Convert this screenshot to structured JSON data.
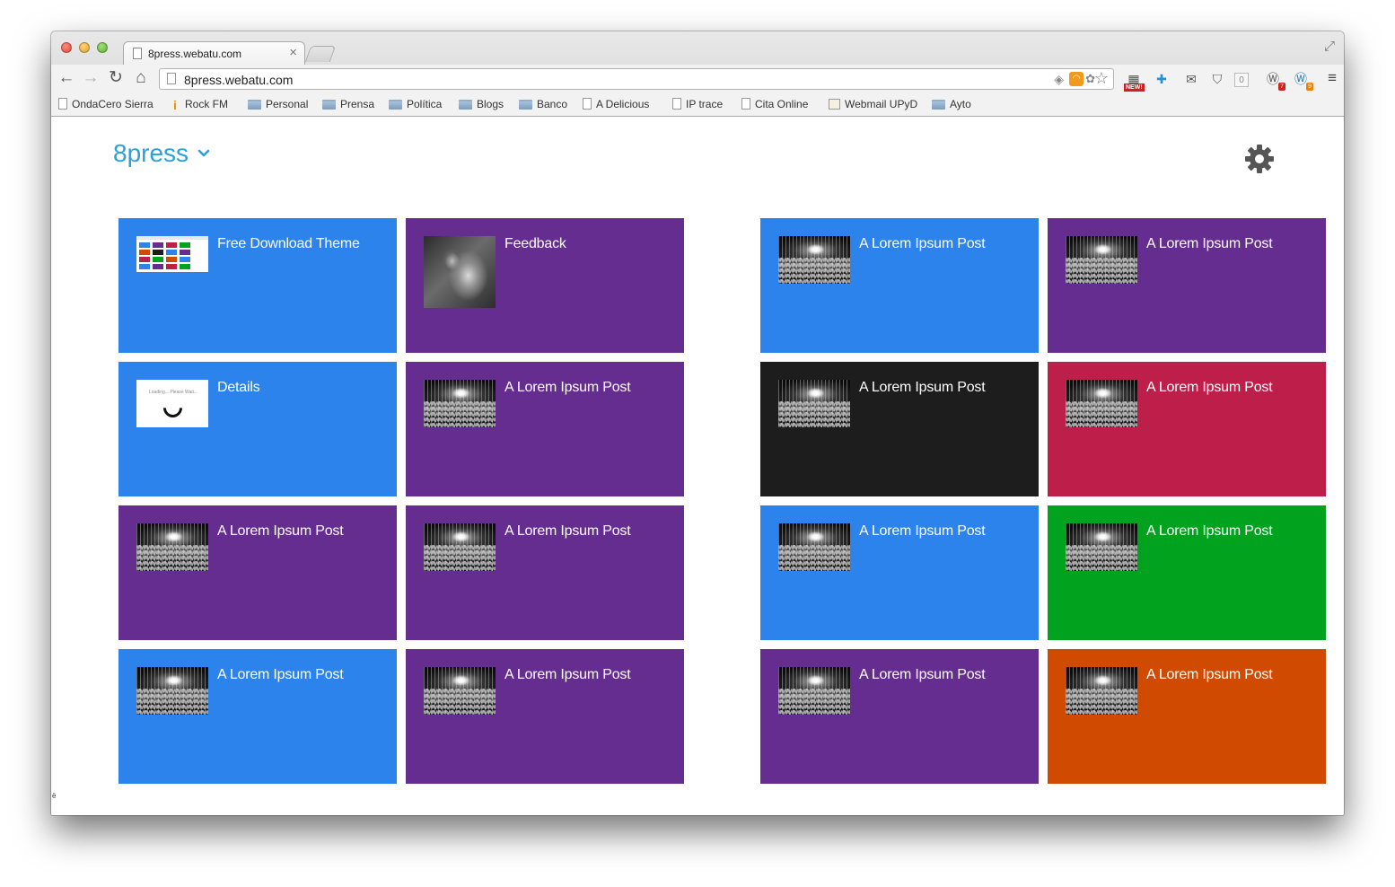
{
  "browser": {
    "tab_title": "8press.webatu.com",
    "url": "8press.webatu.com",
    "bookmarks": [
      {
        "label": "OndaCero Sierra",
        "icon": "page-icon"
      },
      {
        "label": "Rock FM",
        "icon": "radio-icon"
      },
      {
        "label": "Personal",
        "icon": "folder-icon"
      },
      {
        "label": "Prensa",
        "icon": "folder-icon"
      },
      {
        "label": "Política",
        "icon": "folder-icon"
      },
      {
        "label": "Blogs",
        "icon": "folder-icon"
      },
      {
        "label": "Banco",
        "icon": "folder-icon"
      },
      {
        "label": "A Delicious",
        "icon": "page-icon"
      },
      {
        "label": "IP trace",
        "icon": "page-icon"
      },
      {
        "label": "Cita Online",
        "icon": "page-icon"
      },
      {
        "label": "Webmail UPyD",
        "icon": "mail-icon"
      },
      {
        "label": "Ayto",
        "icon": "folder-icon"
      }
    ],
    "extensions": {
      "new_badge": "NEW!",
      "counter": "0",
      "wp_badge_1": "7",
      "wp_badge_2": "9"
    }
  },
  "page": {
    "brand": "8press",
    "colors": {
      "brand": "#2d9fd9",
      "blue": "#2c83ec",
      "purple": "#662d91",
      "black": "#1d1d1d",
      "crimson": "#be1e4a",
      "green": "#00a21e",
      "orange": "#d04a02"
    },
    "tiles_left": [
      {
        "title": "Free Download Theme",
        "color": "#2c83ec",
        "thumb": "theme-screenshot"
      },
      {
        "title": "Feedback",
        "color": "#662d91",
        "thumb": "wolf-photo"
      },
      {
        "title": "Details",
        "color": "#2c83ec",
        "thumb": "loading-screenshot"
      },
      {
        "title": "A Lorem Ipsum Post",
        "color": "#662d91",
        "thumb": "concert-photo"
      },
      {
        "title": "A Lorem Ipsum Post",
        "color": "#662d91",
        "thumb": "concert-photo"
      },
      {
        "title": "A Lorem Ipsum Post",
        "color": "#662d91",
        "thumb": "concert-photo"
      },
      {
        "title": "A Lorem Ipsum Post",
        "color": "#2c83ec",
        "thumb": "concert-photo"
      },
      {
        "title": "A Lorem Ipsum Post",
        "color": "#662d91",
        "thumb": "concert-photo"
      }
    ],
    "tiles_right": [
      {
        "title": "A Lorem Ipsum Post",
        "color": "#2c83ec",
        "thumb": "concert-photo"
      },
      {
        "title": "A Lorem Ipsum Post",
        "color": "#662d91",
        "thumb": "concert-photo"
      },
      {
        "title": "A Lorem Ipsum Post",
        "color": "#1d1d1d",
        "thumb": "concert-photo"
      },
      {
        "title": "A Lorem Ipsum Post",
        "color": "#be1e4a",
        "thumb": "concert-photo"
      },
      {
        "title": "A Lorem Ipsum Post",
        "color": "#2c83ec",
        "thumb": "concert-photo"
      },
      {
        "title": "A Lorem Ipsum Post",
        "color": "#00a21e",
        "thumb": "concert-photo"
      },
      {
        "title": "A Lorem Ipsum Post",
        "color": "#662d91",
        "thumb": "concert-photo"
      },
      {
        "title": "A Lorem Ipsum Post",
        "color": "#d04a02",
        "thumb": "concert-photo"
      }
    ],
    "loading_text": "Loading... Please Wait..."
  }
}
